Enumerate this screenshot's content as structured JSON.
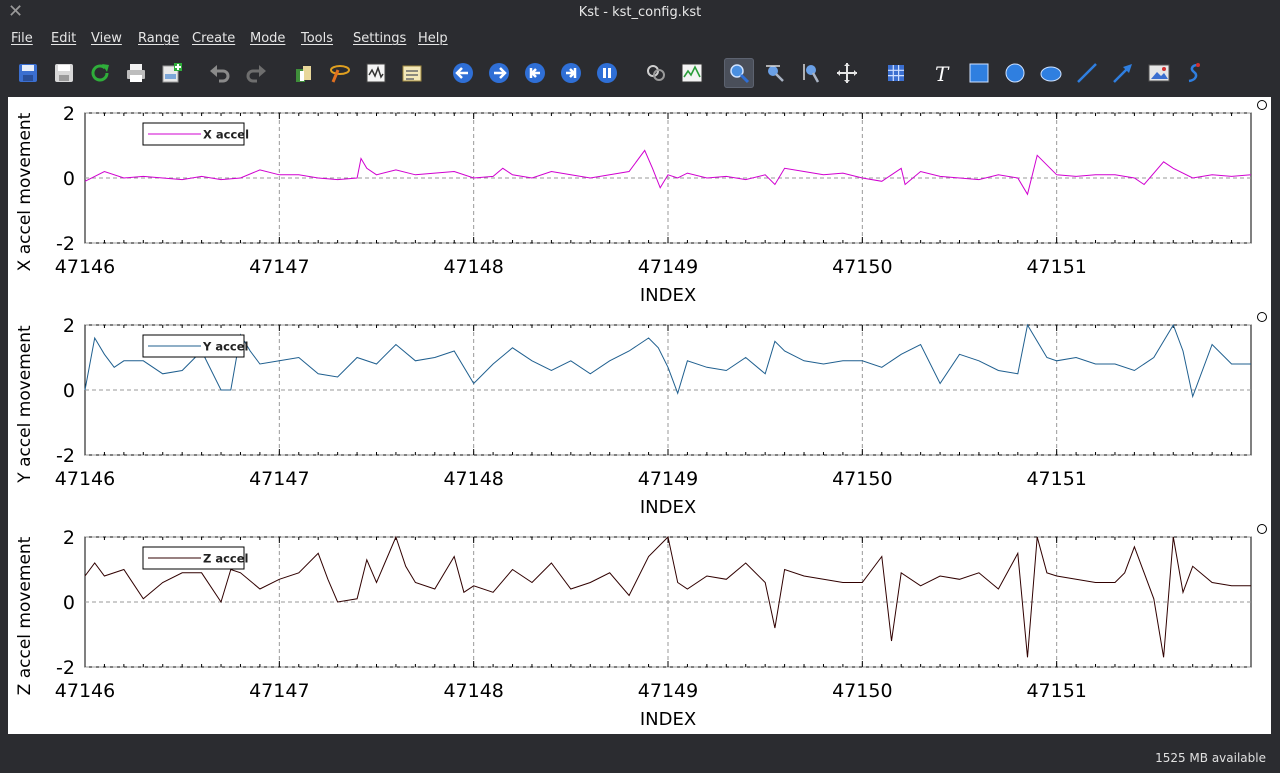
{
  "window": {
    "title": "Kst - kst_config.kst",
    "close_glyph": "✕"
  },
  "menu": [
    "File",
    "Edit",
    "View",
    "Range",
    "Create",
    "Mode",
    "Tools",
    "Settings",
    "Help"
  ],
  "toolbar": [
    {
      "icon": "save-icon"
    },
    {
      "icon": "save-as-icon"
    },
    {
      "icon": "reload-icon"
    },
    {
      "icon": "print-icon"
    },
    {
      "icon": "export-image-icon"
    },
    {
      "icon": "undo-icon"
    },
    {
      "icon": "redo-icon"
    },
    {
      "icon": "data-manager-icon"
    },
    {
      "icon": "data-wizard-icon"
    },
    {
      "icon": "change-data-file-icon"
    },
    {
      "icon": "edit-vectors-icon"
    },
    {
      "icon": "back-icon"
    },
    {
      "icon": "forward-icon"
    },
    {
      "icon": "first-frame-icon"
    },
    {
      "icon": "last-frame-icon"
    },
    {
      "icon": "pause-icon"
    },
    {
      "icon": "layout-mode-icon"
    },
    {
      "icon": "xy-mode-icon"
    },
    {
      "icon": "zoom-mode-icon",
      "active": true
    },
    {
      "icon": "zoom-x-icon"
    },
    {
      "icon": "zoom-y-icon"
    },
    {
      "icon": "move-icon"
    },
    {
      "icon": "grid-layout-icon"
    },
    {
      "icon": "text-tool-icon"
    },
    {
      "icon": "box-tool-icon"
    },
    {
      "icon": "circle-tool-icon"
    },
    {
      "icon": "ellipse-tool-icon"
    },
    {
      "icon": "line-tool-icon"
    },
    {
      "icon": "arrow-tool-icon"
    },
    {
      "icon": "picture-tool-icon"
    },
    {
      "icon": "svg-tool-icon"
    }
  ],
  "status": {
    "memory": "1525 MB available"
  },
  "chart_data": [
    {
      "type": "line",
      "title": "",
      "xlabel": "INDEX",
      "ylabel": "X accel movement",
      "xlim": [
        47146,
        47152
      ],
      "ylim": [
        -2,
        2
      ],
      "x_ticks": [
        "47146",
        "47147",
        "47148",
        "47149",
        "47150",
        "47151"
      ],
      "y_ticks": [
        "2",
        "0",
        "-2"
      ],
      "grid": true,
      "legend": "top-left",
      "series": [
        {
          "name": "X accel",
          "color": "#d000d0",
          "x": [
            47146.0,
            47146.1,
            47146.2,
            47146.3,
            47146.4,
            47146.5,
            47146.6,
            47146.7,
            47146.8,
            47146.9,
            47147.0,
            47147.1,
            47147.2,
            47147.3,
            47147.4,
            47147.42,
            47147.45,
            47147.5,
            47147.6,
            47147.7,
            47147.8,
            47147.9,
            47148.0,
            47148.1,
            47148.15,
            47148.2,
            47148.3,
            47148.4,
            47148.5,
            47148.6,
            47148.7,
            47148.8,
            47148.88,
            47148.92,
            47148.96,
            47149.0,
            47149.05,
            47149.1,
            47149.2,
            47149.3,
            47149.4,
            47149.5,
            47149.55,
            47149.6,
            47149.7,
            47149.8,
            47149.9,
            47150.0,
            47150.1,
            47150.2,
            47150.22,
            47150.3,
            47150.4,
            47150.5,
            47150.6,
            47150.7,
            47150.8,
            47150.85,
            47150.9,
            47151.0,
            47151.1,
            47151.2,
            47151.3,
            47151.4,
            47151.45,
            47151.55,
            47151.6,
            47151.7,
            47151.8,
            47151.9,
            47152.0
          ],
          "y": [
            -0.1,
            0.2,
            0.0,
            0.05,
            0.0,
            -0.05,
            0.05,
            -0.05,
            0.0,
            0.25,
            0.1,
            0.1,
            0.0,
            -0.05,
            0.0,
            0.6,
            0.3,
            0.1,
            0.25,
            0.1,
            0.15,
            0.2,
            0.0,
            0.05,
            0.3,
            0.1,
            0.0,
            0.2,
            0.1,
            0.0,
            0.1,
            0.2,
            0.85,
            0.3,
            -0.3,
            0.1,
            0.0,
            0.15,
            0.0,
            0.05,
            -0.05,
            0.1,
            -0.2,
            0.3,
            0.2,
            0.1,
            0.15,
            0.0,
            -0.1,
            0.3,
            -0.2,
            0.2,
            0.05,
            0.0,
            -0.05,
            0.1,
            0.0,
            -0.5,
            0.7,
            0.1,
            0.05,
            0.1,
            0.1,
            0.0,
            -0.2,
            0.5,
            0.3,
            0.0,
            0.1,
            0.05,
            0.1
          ]
        }
      ]
    },
    {
      "type": "line",
      "title": "",
      "xlabel": "INDEX",
      "ylabel": "Y accel movement",
      "xlim": [
        47146,
        47152
      ],
      "ylim": [
        -2,
        2
      ],
      "x_ticks": [
        "47146",
        "47147",
        "47148",
        "47149",
        "47150",
        "47151"
      ],
      "y_ticks": [
        "2",
        "0",
        "-2"
      ],
      "grid": true,
      "legend": "top-left",
      "series": [
        {
          "name": "Y accel",
          "color": "#1f5f8f",
          "x": [
            47146.0,
            47146.05,
            47146.1,
            47146.15,
            47146.2,
            47146.3,
            47146.4,
            47146.5,
            47146.6,
            47146.7,
            47146.75,
            47146.8,
            47146.85,
            47146.9,
            47147.0,
            47147.1,
            47147.2,
            47147.3,
            47147.4,
            47147.5,
            47147.6,
            47147.7,
            47147.8,
            47147.9,
            47148.0,
            47148.1,
            47148.2,
            47148.3,
            47148.4,
            47148.5,
            47148.6,
            47148.7,
            47148.8,
            47148.9,
            47148.95,
            47149.0,
            47149.05,
            47149.1,
            47149.2,
            47149.3,
            47149.4,
            47149.5,
            47149.55,
            47149.6,
            47149.7,
            47149.8,
            47149.9,
            47150.0,
            47150.1,
            47150.2,
            47150.3,
            47150.4,
            47150.5,
            47150.6,
            47150.7,
            47150.8,
            47150.85,
            47150.9,
            47150.95,
            47151.0,
            47151.1,
            47151.2,
            47151.3,
            47151.4,
            47151.5,
            47151.6,
            47151.65,
            47151.7,
            47151.8,
            47151.9,
            47152.0
          ],
          "y": [
            0.0,
            1.6,
            1.1,
            0.7,
            0.9,
            0.9,
            0.5,
            0.6,
            1.2,
            0.0,
            0.0,
            1.7,
            1.2,
            0.8,
            0.9,
            1.0,
            0.5,
            0.4,
            1.0,
            0.8,
            1.4,
            0.9,
            1.0,
            1.2,
            0.2,
            0.8,
            1.3,
            0.9,
            0.6,
            0.9,
            0.5,
            0.9,
            1.2,
            1.6,
            1.3,
            0.7,
            -0.1,
            0.9,
            0.7,
            0.6,
            1.0,
            0.5,
            1.5,
            1.2,
            0.9,
            0.8,
            0.9,
            0.9,
            0.7,
            1.1,
            1.4,
            0.2,
            1.1,
            0.9,
            0.6,
            0.5,
            2.0,
            1.5,
            1.0,
            0.9,
            1.0,
            0.8,
            0.8,
            0.6,
            1.0,
            2.0,
            1.2,
            -0.2,
            1.4,
            0.8,
            0.8
          ]
        }
      ]
    },
    {
      "type": "line",
      "title": "",
      "xlabel": "INDEX",
      "ylabel": "Z accel movement",
      "xlim": [
        47146,
        47152
      ],
      "ylim": [
        -2,
        2
      ],
      "x_ticks": [
        "47146",
        "47147",
        "47148",
        "47149",
        "47150",
        "47151"
      ],
      "y_ticks": [
        "2",
        "0",
        "-2"
      ],
      "grid": true,
      "legend": "top-left",
      "series": [
        {
          "name": "Z accel",
          "color": "#300000",
          "x": [
            47146.0,
            47146.05,
            47146.1,
            47146.2,
            47146.3,
            47146.4,
            47146.5,
            47146.6,
            47146.7,
            47146.75,
            47146.8,
            47146.9,
            47147.0,
            47147.1,
            47147.2,
            47147.25,
            47147.3,
            47147.4,
            47147.45,
            47147.5,
            47147.6,
            47147.65,
            47147.7,
            47147.8,
            47147.9,
            47147.95,
            47148.0,
            47148.1,
            47148.2,
            47148.3,
            47148.4,
            47148.5,
            47148.6,
            47148.7,
            47148.8,
            47148.9,
            47149.0,
            47149.05,
            47149.1,
            47149.2,
            47149.3,
            47149.4,
            47149.5,
            47149.55,
            47149.6,
            47149.7,
            47149.8,
            47149.9,
            47150.0,
            47150.1,
            47150.15,
            47150.2,
            47150.3,
            47150.4,
            47150.5,
            47150.6,
            47150.7,
            47150.8,
            47150.85,
            47150.9,
            47150.95,
            47151.0,
            47151.1,
            47151.2,
            47151.3,
            47151.35,
            47151.4,
            47151.5,
            47151.55,
            47151.6,
            47151.65,
            47151.7,
            47151.8,
            47151.9,
            47152.0
          ],
          "y": [
            0.8,
            1.2,
            0.8,
            1.0,
            0.1,
            0.6,
            0.9,
            0.9,
            0.0,
            1.0,
            0.9,
            0.4,
            0.7,
            0.9,
            1.5,
            0.7,
            0.0,
            0.1,
            1.3,
            0.6,
            2.0,
            1.1,
            0.6,
            0.4,
            1.4,
            0.3,
            0.5,
            0.3,
            1.0,
            0.6,
            1.2,
            0.4,
            0.6,
            0.9,
            0.2,
            1.4,
            2.0,
            0.6,
            0.4,
            0.8,
            0.7,
            1.2,
            0.6,
            -0.8,
            1.0,
            0.8,
            0.7,
            0.6,
            0.6,
            1.4,
            -1.2,
            0.9,
            0.5,
            0.8,
            0.7,
            0.9,
            0.4,
            1.5,
            -1.7,
            2.0,
            0.9,
            0.8,
            0.7,
            0.6,
            0.6,
            0.9,
            1.7,
            0.1,
            -1.7,
            2.0,
            0.3,
            1.1,
            0.6,
            0.5,
            0.5
          ]
        }
      ]
    }
  ]
}
